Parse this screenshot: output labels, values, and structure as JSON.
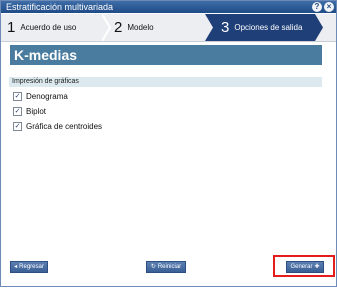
{
  "window": {
    "title": "Estratificación multivariada",
    "controls": [
      "?",
      "×"
    ]
  },
  "wizard": {
    "steps": [
      {
        "num": "1",
        "label": "Acuerdo de uso"
      },
      {
        "num": "2",
        "label": "Modelo"
      },
      {
        "num": "3",
        "label": "Opciones de salida"
      }
    ],
    "active_step": 3
  },
  "page": {
    "title": "K-medias"
  },
  "section": {
    "title": "Impresión de gráficas",
    "options": [
      {
        "label": "Denograma",
        "checked": true
      },
      {
        "label": "Biplot",
        "checked": true
      },
      {
        "label": "Gráfica de centroides",
        "checked": true
      }
    ]
  },
  "footer": {
    "back": {
      "icon": "◂",
      "label": "Regresar"
    },
    "reset": {
      "icon": "↻",
      "label": "Reiniciar"
    },
    "generate": {
      "label": "Generar",
      "icon": "✚"
    }
  },
  "colors": {
    "accent_dark": "#1f3f78",
    "title_bg": "#4a7c9f",
    "highlight": "#e41c1c"
  }
}
